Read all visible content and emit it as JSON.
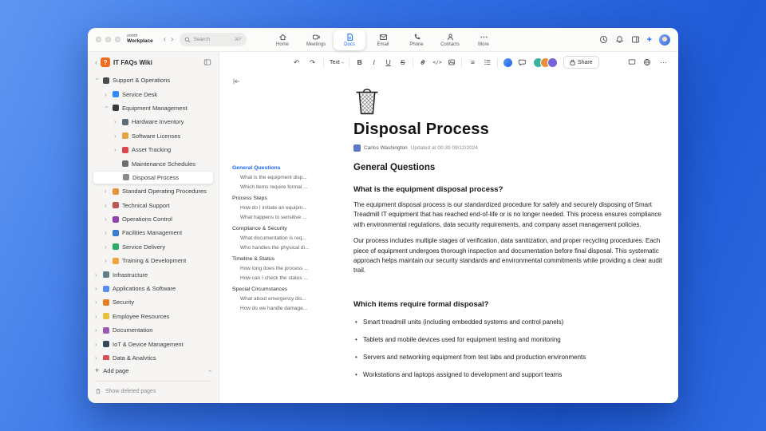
{
  "window": {
    "brand": {
      "line1": "zoom",
      "line2": "Workplace"
    },
    "search": {
      "placeholder": "Search",
      "shortcut": "⌘F"
    },
    "nav_tabs": [
      {
        "label": "Home",
        "icon": "home",
        "active": false
      },
      {
        "label": "Meetings",
        "icon": "meetings",
        "active": false
      },
      {
        "label": "Docs",
        "icon": "docs",
        "active": true
      },
      {
        "label": "Email",
        "icon": "email",
        "active": false
      },
      {
        "label": "Phone",
        "icon": "phone",
        "active": false
      },
      {
        "label": "Contacts",
        "icon": "contacts",
        "active": false
      },
      {
        "label": "More",
        "icon": "more",
        "active": false
      }
    ]
  },
  "sidebar": {
    "title": "IT FAQs Wiki",
    "items": [
      {
        "label": "Support & Operations",
        "depth": 0,
        "expanded": true,
        "icon": "phone",
        "color": "#4a4a4a"
      },
      {
        "label": "Service Desk",
        "depth": 1,
        "expanded": false,
        "icon": "service-desk",
        "color": "#2d8cff"
      },
      {
        "label": "Equipment Management",
        "depth": 1,
        "expanded": true,
        "icon": "equipment",
        "color": "#3a3a3a"
      },
      {
        "label": "Hardware Inventory",
        "depth": 2,
        "expanded": false,
        "icon": "hardware",
        "color": "#5f6b75"
      },
      {
        "label": "Software Licenses",
        "depth": 2,
        "expanded": false,
        "icon": "software",
        "color": "#e8a33d"
      },
      {
        "label": "Asset Tracking",
        "depth": 2,
        "expanded": false,
        "icon": "asset-pin",
        "color": "#e0474c"
      },
      {
        "label": "Maintenance Schedules",
        "depth": 2,
        "expanded": null,
        "icon": "wrench",
        "color": "#6d6d6d"
      },
      {
        "label": "Disposal Process",
        "depth": 2,
        "expanded": null,
        "icon": "trash",
        "color": "#8a8a8a",
        "selected": true
      },
      {
        "label": "Standard Operating Procedures",
        "depth": 1,
        "expanded": false,
        "icon": "sop",
        "color": "#e8913d"
      },
      {
        "label": "Technical Support",
        "depth": 1,
        "expanded": false,
        "icon": "tech-support",
        "color": "#c0564f"
      },
      {
        "label": "Operations Control",
        "depth": 1,
        "expanded": false,
        "icon": "operations",
        "color": "#8e44ad"
      },
      {
        "label": "Facilities Management",
        "depth": 1,
        "expanded": false,
        "icon": "facilities",
        "color": "#3a7bd5"
      },
      {
        "label": "Service Delivery",
        "depth": 1,
        "expanded": false,
        "icon": "delivery",
        "color": "#27ae60"
      },
      {
        "label": "Training & Development",
        "depth": 1,
        "expanded": false,
        "icon": "training",
        "color": "#f2a33c"
      },
      {
        "label": "Infrastructure",
        "depth": 0,
        "expanded": false,
        "icon": "infrastructure",
        "color": "#607d8b"
      },
      {
        "label": "Applications & Software",
        "depth": 0,
        "expanded": false,
        "icon": "apps",
        "color": "#5b8def"
      },
      {
        "label": "Security",
        "depth": 0,
        "expanded": false,
        "icon": "security",
        "color": "#e67e22"
      },
      {
        "label": "Employee Resources",
        "depth": 0,
        "expanded": false,
        "icon": "employees",
        "color": "#e8c23d"
      },
      {
        "label": "Documentation",
        "depth": 0,
        "expanded": false,
        "icon": "documentation",
        "color": "#9b59b6"
      },
      {
        "label": "IoT & Device Management",
        "depth": 0,
        "expanded": false,
        "icon": "iot",
        "color": "#34495e"
      },
      {
        "label": "Data & Analytics",
        "depth": 0,
        "expanded": false,
        "icon": "analytics",
        "color": "#d95252"
      }
    ],
    "add_page": "Add page",
    "show_deleted": "Show deleted pages"
  },
  "toolbar": {
    "text_style": "Text",
    "share_label": "Share"
  },
  "outline": {
    "sections": [
      {
        "label": "General Questions",
        "active": true,
        "children": [
          "What is the equipment disp...",
          "Which items require formal ..."
        ]
      },
      {
        "label": "Process Steps",
        "active": false,
        "children": [
          "How do I initiate an equipm...",
          "What happens to sensitive ..."
        ]
      },
      {
        "label": "Compliance & Security",
        "active": false,
        "children": [
          "What documentation is req...",
          "Who handles the physical di..."
        ]
      },
      {
        "label": "Timeline & Status",
        "active": false,
        "children": [
          "How long does the process ...",
          "How can I check the status ..."
        ]
      },
      {
        "label": "Special Circumstances",
        "active": false,
        "children": [
          "What about emergency dis...",
          "How do we handle damage..."
        ]
      }
    ]
  },
  "doc": {
    "title": "Disposal Process",
    "author": "Carlos Washington",
    "updated": "Updated at 00:39 09/12/2024",
    "heading": "General Questions",
    "q1": {
      "question": "What is the equipment disposal process?",
      "p1": "The equipment disposal process is our standardized procedure for safely and securely disposing of Smart Treadmill IT equipment that has reached end-of-life or is no longer needed. This process ensures compliance with environmental regulations, data security requirements, and company asset management policies.",
      "p2": "Our process includes multiple stages of verification, data sanitization, and proper recycling procedures. Each piece of equipment undergoes thorough inspection and documentation before final disposal. This systematic approach helps maintain our security standards and environmental commitments while providing a clear audit trail."
    },
    "q2": {
      "question": "Which items require formal disposal?",
      "bullets": [
        "Smart treadmill units (including embedded systems and control panels)",
        "Tablets and mobile devices used for equipment testing and monitoring",
        "Servers and networking equipment from test labs and production environments",
        "Workstations and laptops assigned to development and support teams"
      ]
    }
  }
}
